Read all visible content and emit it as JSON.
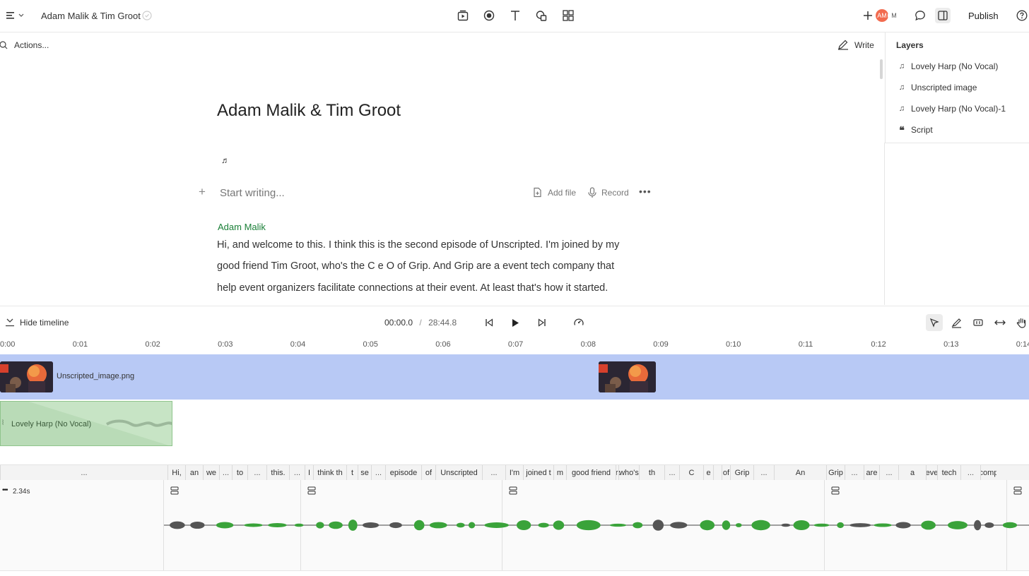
{
  "header": {
    "menu_icon": "menu-icon",
    "doc_title": "Adam Malik & Tim Groot",
    "publish_label": "Publish",
    "avatars": [
      "AM",
      "M"
    ],
    "accent": "#f26b4f"
  },
  "toolbar": {
    "actions_label": "Actions...",
    "write_label": "Write"
  },
  "layers": {
    "title": "Layers",
    "items": [
      {
        "icon": "music-note-icon",
        "label": "Lovely Harp (No Vocal)"
      },
      {
        "icon": "music-note-icon",
        "label": "Unscripted image"
      },
      {
        "icon": "music-note-icon",
        "label": "Lovely Harp (No Vocal)-1"
      },
      {
        "icon": "quote-icon",
        "label": "Script"
      }
    ]
  },
  "document": {
    "title": "Adam Malik & Tim Groot",
    "placeholder": "Start writing...",
    "add_file_label": "Add file",
    "record_label": "Record",
    "speaker": "Adam Malik",
    "paragraph_lines": [
      "Hi, and welcome to this. I think this is the second episode of Unscripted. I'm joined by my",
      "good friend Tim Groot, who's the C e O of Grip. And Grip are a event tech company that",
      "help event organizers facilitate connections at their event. At least that's how it started."
    ]
  },
  "timeline": {
    "hide_label": "Hide timeline",
    "current_time": "00:00.0",
    "separator": "/",
    "total_time": "28:44.8",
    "ruler_ticks": [
      "0:00",
      "0:01",
      "0:02",
      "0:03",
      "0:04",
      "0:05",
      "0:06",
      "0:07",
      "0:08",
      "0:09",
      "0:10",
      "0:11",
      "0:12",
      "0:13",
      "0:14"
    ],
    "image_track_label": "Unscripted_image.png",
    "audio_track_label": "Lovely Harp (No Vocal)",
    "clip_duration": "2.34s",
    "words": [
      "...",
      "Hi,",
      "an",
      "we",
      "...",
      "to",
      "...",
      "this.",
      "...",
      "I",
      "think th",
      "t",
      "se",
      "...",
      "episode",
      "of",
      "Unscripted",
      "...",
      "I'm",
      "joined t",
      "m",
      "good friend",
      "Groo",
      "who's",
      "th",
      "...",
      "C",
      "e",
      "",
      "of",
      "Grip",
      "...",
      "An",
      "Grip",
      "...",
      "are",
      "...",
      "a",
      "eve",
      "tech",
      "...",
      "comp"
    ]
  }
}
